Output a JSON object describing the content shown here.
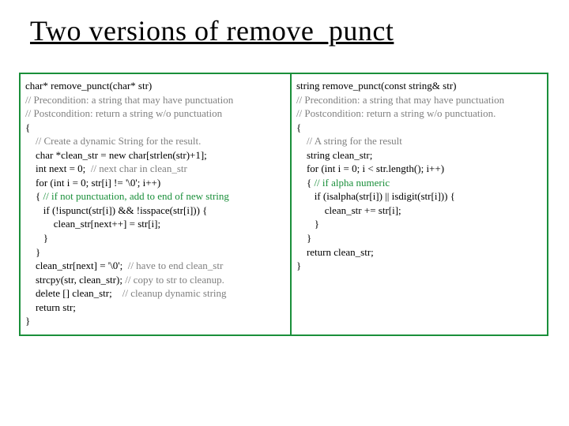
{
  "title": "Two versions of remove_punct",
  "left": {
    "l1": "char* remove_punct(char* str)",
    "l2": "// Precondition: a string that may have punctuation",
    "l3": "// Postcondition: return a string w/o punctuation",
    "l4": "{",
    "l5": "    // Create a dynamic String for the result.",
    "l6": "    char *clean_str = new char[strlen(str)+1];",
    "l7a": "    int next = 0;  ",
    "l7b": "// next char in clean_str",
    "l8": "    for (int i = 0; str[i] != '\\0'; i++)",
    "l9a": "    { ",
    "l9b": "// if not punctuation, add to end of new string",
    "l10": "       if (!ispunct(str[i]) && !isspace(str[i])) {",
    "l11": "           clean_str[next++] = str[i];",
    "l12": "       }",
    "l13": "    }",
    "l14a": "    clean_str[next] = '\\0';  ",
    "l14b": "// have to end clean_str",
    "l15a": "    strcpy(str, clean_str); ",
    "l15b": "// copy to str to cleanup.",
    "l16a": "    delete [] clean_str;    ",
    "l16b": "// cleanup dynamic string",
    "l17": "    return str;",
    "l18": "}"
  },
  "right": {
    "r1": "string remove_punct(const string& str)",
    "r2": "// Precondition: a string that may have punctuation",
    "r3": "// Postcondition: return a string w/o punctuation.",
    "r4": "{",
    "r5": "    // A string for the result",
    "r6": "    string clean_str;",
    "r7": "    for (int i = 0; i < str.length(); i++)",
    "r8a": "    { ",
    "r8b": "// if alpha numeric",
    "r9": "       if (isalpha(str[i]) || isdigit(str[i])) {",
    "r10": "           clean_str += str[i];",
    "r11": "       }",
    "r12": "    }",
    "r13": "    return clean_str;",
    "r14": "}"
  }
}
